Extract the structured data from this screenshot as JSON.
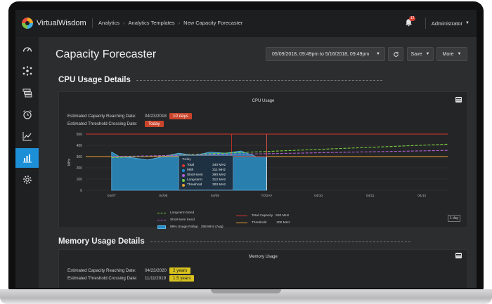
{
  "app": {
    "name": "VirtualWisdom"
  },
  "breadcrumb": [
    "Analytics",
    "Analytics Templates",
    "New Capacity Forecaster"
  ],
  "header": {
    "notification_count": "12",
    "user": "Administrator"
  },
  "page": {
    "title": "Capacity Forecaster",
    "date_range": "05/09/2018, 09:49pm to 5/16/2018, 09:49pm",
    "save_label": "Save",
    "more_label": "More"
  },
  "sidebar": {
    "items": [
      {
        "icon": "speedometer-icon",
        "active": false
      },
      {
        "icon": "network-icon",
        "active": false
      },
      {
        "icon": "layers-icon",
        "active": false
      },
      {
        "icon": "alarm-clock-icon",
        "active": false
      },
      {
        "icon": "trend-icon",
        "active": false
      },
      {
        "icon": "analytics-icon",
        "active": true
      },
      {
        "icon": "gear-icon",
        "active": false
      }
    ]
  },
  "cpu": {
    "section_title": "CPU Usage Details",
    "panel_title": "CPU Usage",
    "capacity_label": "Estimated Capacity Reaching Date:",
    "capacity_date": "04/23/2018",
    "capacity_badge": "10 days",
    "threshold_label": "Estimated Threshold Crossing Date:",
    "threshold_badge": "Today",
    "tooltip": {
      "header": "Today",
      "rows": [
        {
          "name": "Total",
          "value": "340 MHz",
          "color": "#e0342b"
        },
        {
          "name": "99th",
          "value": "311 MHz",
          "color": "#1d8fd6"
        },
        {
          "name": "Short-term",
          "value": "290 MHz",
          "color": "#b35fd6"
        },
        {
          "name": "Long-term",
          "value": "312 MHz",
          "color": "#7ad13e"
        },
        {
          "name": "Threshold",
          "value": "300 MHz",
          "color": "#f0a030"
        }
      ]
    },
    "legend": {
      "long_term": "Long-term trend",
      "short_term": "Short-term trend",
      "rollup": "99% Usage Rollup",
      "rollup_value": "298 MHz (Avg)",
      "total_capacity": "Total Capacity",
      "total_capacity_value": "500 MHz",
      "threshold": "Threshold",
      "threshold_value": "300 MHz"
    },
    "range_button": "1 day"
  },
  "memory": {
    "section_title": "Memory Usage Details",
    "panel_title": "Memory Usage",
    "capacity_label": "Estimated Capacity Reaching Date:",
    "capacity_date": "04/23/2020",
    "capacity_badge": "2 years",
    "threshold_label": "Estimated Threshold Crossing Date:",
    "threshold_date": "11/11/2019",
    "threshold_badge": "1.5 years"
  },
  "colors": {
    "accent": "#1d8fd6",
    "capacity_line": "#d8342b",
    "threshold_line": "#f0a030",
    "long_term": "#7ad13e",
    "short_term": "#b35fd6",
    "area": "#2a8fc7"
  },
  "chart_data": {
    "type": "line",
    "ylabel": "MHz",
    "ylim": [
      0,
      500
    ],
    "yticks": [
      0,
      100,
      200,
      300,
      400,
      500
    ],
    "xticks": [
      "04/07",
      "04/08",
      "04/09",
      "TODAY",
      "04/10",
      "04/11",
      "04/12"
    ],
    "today_index": 3,
    "capacity": 500,
    "threshold": 300,
    "usage_history": {
      "x": [
        0,
        0.15,
        0.4,
        0.7,
        1.0,
        1.3,
        1.6,
        1.9,
        2.2,
        2.5,
        2.8,
        3.0
      ],
      "y": [
        340,
        300,
        290,
        270,
        300,
        330,
        310,
        340,
        330,
        350,
        300,
        300
      ]
    },
    "long_term_trend": {
      "x": [
        0,
        6.5
      ],
      "y": [
        290,
        410
      ]
    },
    "short_term_trend": {
      "x": [
        0,
        6.5
      ],
      "y": [
        300,
        355
      ]
    },
    "grid": true
  }
}
